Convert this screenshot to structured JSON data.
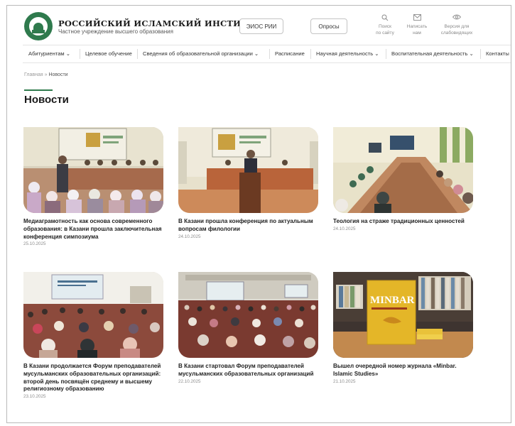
{
  "header": {
    "org_name": "РОССИЙСКИЙ ИСЛАМСКИЙ ИНСТИТУТ",
    "org_subtitle": "Частное учреждение высшего образования",
    "eios_label": "ЭИОС РИИ",
    "polls_label": "Опросы",
    "search": {
      "icon": "search-icon",
      "line1": "Поиск",
      "line2": "по сайту"
    },
    "write": {
      "icon": "envelope-icon",
      "line1": "Написать",
      "line2": "нам"
    },
    "vision": {
      "icon": "eye-icon",
      "line1": "Версия для",
      "line2": "слабовидящих"
    }
  },
  "nav": {
    "items": [
      {
        "label": "Абитуриентам ⌄"
      },
      {
        "label": "Целевое обучение"
      },
      {
        "label": "Сведения об образовательной организации ⌄"
      },
      {
        "label": "Расписание"
      },
      {
        "label": "Научная деятельность ⌄"
      },
      {
        "label": "Воспитательная деятельность ⌄"
      },
      {
        "label": "Контакты"
      }
    ]
  },
  "breadcrumb": {
    "home": "Главная",
    "separator": "»",
    "current": "Новости"
  },
  "page_title": "Новости",
  "accent_color": "#2f7a4d",
  "news": [
    {
      "title": "Медиаграмотность как основа современного образования: в Казани прошла заключительная конференция симпозиума",
      "date": "25.10.2025"
    },
    {
      "title": "В Казани прошла конференция по актуальным вопросам филологии",
      "date": "24.10.2025"
    },
    {
      "title": "Теология на страже традиционных ценностей",
      "date": "24.10.2025"
    },
    {
      "title": "В Казани продолжается Форум преподавателей мусульманских образовательных организаций: второй день посвящён среднему и высшему религиозному образованию",
      "date": "23.10.2025"
    },
    {
      "title": "В Казани стартовал Форум преподавателей мусульманских образовательных организаций",
      "date": "22.10.2025"
    },
    {
      "title": "Вышел очередной номер журнала «Minbar. Islamic Studies»",
      "date": "21.10.2025"
    }
  ],
  "journal_cover": {
    "text": "MINBAR"
  }
}
